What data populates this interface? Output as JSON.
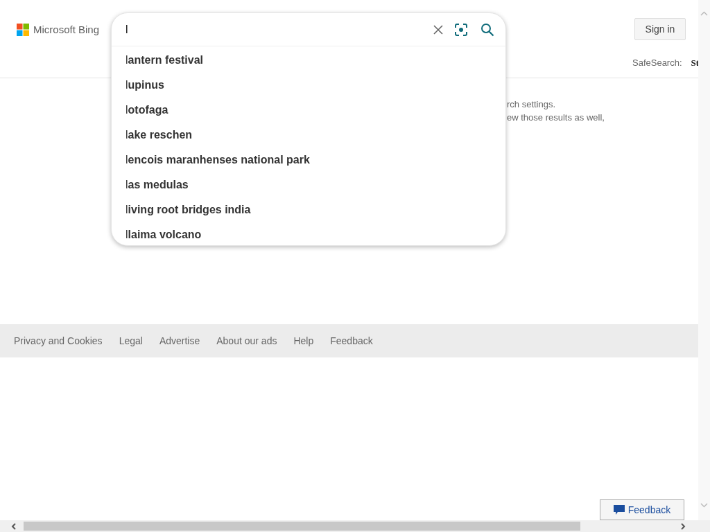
{
  "brand": "Microsoft Bing",
  "search": {
    "value": "l"
  },
  "suggestions": [
    "l**antern festival**",
    "l**upinus**",
    "l**otofaga**",
    "l**ake reschen**",
    "l**encois maranhenses national park**",
    "l**as medulas**",
    "l**iving root bridges india**",
    "l**laima volcano**"
  ],
  "sign_in": "Sign in",
  "safesearch": {
    "label": "SafeSearch:",
    "value": "St"
  },
  "message_lines": [
    "rch settings.",
    "ew those results as well,"
  ],
  "footer_links": [
    "Privacy and Cookies",
    "Legal",
    "Advertise",
    "About our ads",
    "Help",
    "Feedback"
  ],
  "feedback_button": "Feedback"
}
